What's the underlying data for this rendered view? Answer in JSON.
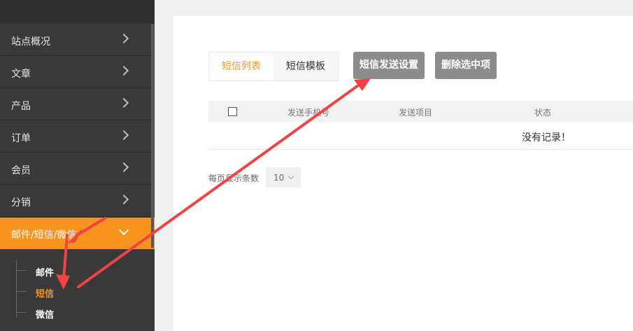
{
  "sidebar": {
    "items": [
      {
        "label": "站点概况"
      },
      {
        "label": "文章"
      },
      {
        "label": "产品"
      },
      {
        "label": "订单"
      },
      {
        "label": "会员"
      },
      {
        "label": "分销"
      },
      {
        "label": "邮件/短信/微信"
      }
    ],
    "sub_items": [
      {
        "label": "邮件"
      },
      {
        "label": "短信"
      },
      {
        "label": "微信"
      }
    ],
    "active_index": 6,
    "active_sub_index": 1
  },
  "main": {
    "tabs": [
      {
        "label": "短信列表"
      },
      {
        "label": "短信模板"
      }
    ],
    "buttons": {
      "send_settings": "短信发送设置",
      "delete_selected": "删除选中项"
    },
    "table": {
      "headers": [
        "发送手机号",
        "发送项目",
        "状态"
      ],
      "empty_message": "没有记录！"
    },
    "pagination": {
      "per_page_label": "每页显示条数",
      "per_page_value": "10"
    }
  },
  "colors": {
    "accent": "#f7941d",
    "sidebar_bg": "#393939",
    "button_gray": "#8c8c8c",
    "annotation_red": "#f04444"
  }
}
